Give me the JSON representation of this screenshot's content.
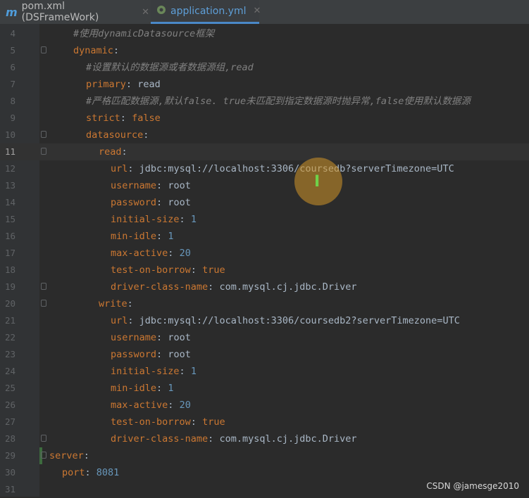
{
  "tabs": [
    {
      "label": "pom.xml (DSFrameWork)",
      "icon": "maven-icon",
      "active": false
    },
    {
      "label": "application.yml",
      "icon": "spring-config-icon",
      "active": true
    }
  ],
  "editor": {
    "current_line": "11",
    "lines": [
      {
        "n": "4",
        "t": "#使用dynamicDatasource框架"
      },
      {
        "n": "5",
        "k": "dynamic",
        "p": ":"
      },
      {
        "n": "6",
        "t": "#设置默认的数据源或者数据源组,read"
      },
      {
        "n": "7",
        "k": "primary",
        "p": ":",
        "v": "read"
      },
      {
        "n": "8",
        "t": "#严格匹配数据源,默认false. true未匹配到指定数据源时抛异常,false使用默认数据源"
      },
      {
        "n": "9",
        "k": "strict",
        "p": ":",
        "v": "false"
      },
      {
        "n": "10",
        "k": "datasource",
        "p": ":"
      },
      {
        "n": "11",
        "k": "read",
        "p": ":"
      },
      {
        "n": "12",
        "k": "url",
        "p": ":",
        "v": "jdbc:mysql://localhost:3306/coursedb?serverTimezone=UTC"
      },
      {
        "n": "13",
        "k": "username",
        "p": ":",
        "v": "root"
      },
      {
        "n": "14",
        "k": "password",
        "p": ":",
        "v": "root"
      },
      {
        "n": "15",
        "k": "initial-size",
        "p": ":",
        "v": "1"
      },
      {
        "n": "16",
        "k": "min-idle",
        "p": ":",
        "v": "1"
      },
      {
        "n": "17",
        "k": "max-active",
        "p": ":",
        "v": "20"
      },
      {
        "n": "18",
        "k": "test-on-borrow",
        "p": ":",
        "v": "true"
      },
      {
        "n": "19",
        "k": "driver-class-name",
        "p": ":",
        "v": "com.mysql.cj.jdbc.Driver"
      },
      {
        "n": "20",
        "k": "write",
        "p": ":"
      },
      {
        "n": "21",
        "k": "url",
        "p": ":",
        "v": "jdbc:mysql://localhost:3306/coursedb2?serverTimezone=UTC"
      },
      {
        "n": "22",
        "k": "username",
        "p": ":",
        "v": "root"
      },
      {
        "n": "23",
        "k": "password",
        "p": ":",
        "v": "root"
      },
      {
        "n": "24",
        "k": "initial-size",
        "p": ":",
        "v": "1"
      },
      {
        "n": "25",
        "k": "min-idle",
        "p": ":",
        "v": "1"
      },
      {
        "n": "26",
        "k": "max-active",
        "p": ":",
        "v": "20"
      },
      {
        "n": "27",
        "k": "test-on-borrow",
        "p": ":",
        "v": "true"
      },
      {
        "n": "28",
        "k": "driver-class-name",
        "p": ":",
        "v": "com.mysql.cj.jdbc.Driver"
      },
      {
        "n": "29",
        "k": "server",
        "p": ":"
      },
      {
        "n": "30",
        "k": "port",
        "p": ":",
        "v": "8081"
      },
      {
        "n": "31"
      }
    ]
  },
  "cursor": {
    "icon": "text-cursor-icon",
    "glyph": "I"
  },
  "watermark": "CSDN @jamesge2010",
  "colors": {
    "keyword": "#cc7832",
    "comment": "#808080",
    "value": "#a9b7c6",
    "number": "#6897bb",
    "background": "#2b2b2b"
  }
}
